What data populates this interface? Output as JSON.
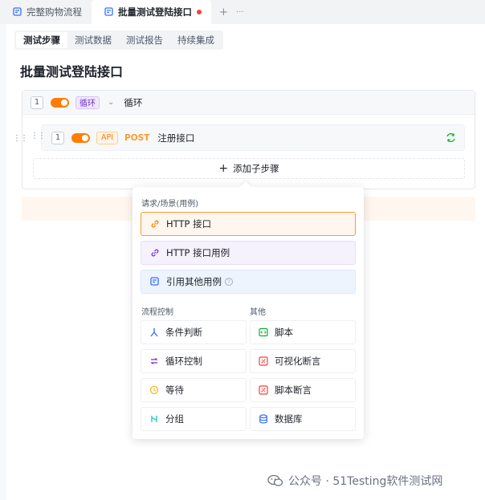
{
  "tabs": [
    {
      "label": "完整购物流程",
      "active": false
    },
    {
      "label": "批量测试登陆接口",
      "active": true,
      "modified": true
    }
  ],
  "tab_tools": {
    "add": "+",
    "more": "···"
  },
  "subtabs": [
    "测试步骤",
    "测试数据",
    "测试报告",
    "持续集成"
  ],
  "page_title": "批量测试登陆接口",
  "loop_step": {
    "index": "1",
    "tag": "循环",
    "name": "循环"
  },
  "api_step": {
    "index": "1",
    "tag": "API",
    "method": "POST",
    "name": "注册接口"
  },
  "add_substep": {
    "icon": "+",
    "label": "添加子步骤"
  },
  "dropdown": {
    "section_requests": "请求/场景(用例)",
    "http_api": "HTTP 接口",
    "http_case": "HTTP 接口用例",
    "ref_case": "引用其他用例",
    "help": "?",
    "section_flow": "流程控制",
    "section_other": "其他",
    "flow_items": [
      "条件判断",
      "循环控制",
      "等待",
      "分组"
    ],
    "other_items": [
      "脚本",
      "可视化断言",
      "脚本断言",
      "数据库"
    ]
  },
  "watermark": "公众号 · 51Testing软件测试网",
  "colors": {
    "accent": "#ff7d00",
    "purple": "#722ed1",
    "blue": "#3370ff",
    "green": "#00b42a",
    "red": "#f53f3f"
  }
}
